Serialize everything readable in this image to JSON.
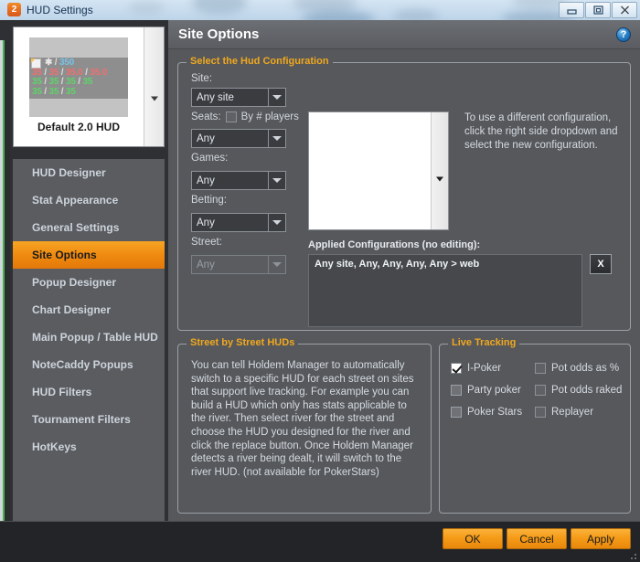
{
  "window": {
    "title": "HUD Settings",
    "icon": "app-badge-icon",
    "badge_text": "2",
    "controls": {
      "minimize": "minimize-icon",
      "maximize": "restore-icon",
      "close": "close-icon"
    }
  },
  "preview": {
    "label": "Default 2.0 HUD",
    "hud_lines": [
      {
        "segments": [
          {
            "t": "✱",
            "c": "nm"
          },
          {
            "t": " / ",
            "c": "sep"
          },
          {
            "t": "350",
            "c": "blue"
          }
        ]
      },
      {
        "segments": [
          {
            "t": "35",
            "c": "red"
          },
          {
            "t": " / ",
            "c": "sep"
          },
          {
            "t": "35",
            "c": "red"
          },
          {
            "t": " / ",
            "c": "sep"
          },
          {
            "t": "35.0",
            "c": "red"
          },
          {
            "t": " / ",
            "c": "sep"
          },
          {
            "t": "35.0",
            "c": "red"
          }
        ]
      },
      {
        "segments": [
          {
            "t": "35",
            "c": "grn"
          },
          {
            "t": " / ",
            "c": "sep"
          },
          {
            "t": "35",
            "c": "grn"
          },
          {
            "t": " / ",
            "c": "sep"
          },
          {
            "t": "35",
            "c": "grn"
          },
          {
            "t": " / ",
            "c": "sep"
          },
          {
            "t": "35",
            "c": "grn"
          }
        ]
      },
      {
        "segments": [
          {
            "t": "35",
            "c": "grn"
          },
          {
            "t": " / ",
            "c": "sep"
          },
          {
            "t": "35",
            "c": "grn"
          },
          {
            "t": " / ",
            "c": "sep"
          },
          {
            "t": "35",
            "c": "grn"
          }
        ]
      }
    ]
  },
  "sidebar": {
    "items": [
      {
        "label": "HUD Designer",
        "active": false
      },
      {
        "label": "Stat Appearance",
        "active": false
      },
      {
        "label": "General Settings",
        "active": false
      },
      {
        "label": "Site Options",
        "active": true
      },
      {
        "label": "Popup Designer",
        "active": false
      },
      {
        "label": "Chart Designer",
        "active": false
      },
      {
        "label": "Main Popup / Table HUD",
        "active": false
      },
      {
        "label": "NoteCaddy Popups",
        "active": false
      },
      {
        "label": "HUD Filters",
        "active": false
      },
      {
        "label": "Tournament Filters",
        "active": false
      },
      {
        "label": "HotKeys",
        "active": false
      }
    ]
  },
  "main": {
    "title": "Site Options",
    "help_icon": "question-mark-icon"
  },
  "config_group": {
    "title": "Select the Hud Configuration",
    "fields": {
      "site_label": "Site:",
      "site_value": "Any site",
      "seats_label": "Seats:",
      "seats_checkbox_label": "By # players",
      "seats_value": "Any",
      "games_label": "Games:",
      "games_value": "Any",
      "betting_label": "Betting:",
      "betting_value": "Any",
      "street_label": "Street:",
      "street_value": "Any"
    },
    "hint": "To use a different configuration, click the right side dropdown and select the new configuration.",
    "applied_label": "Applied Configurations (no editing):",
    "applied_rows": [
      "Any site, Any, Any, Any, Any > web"
    ],
    "remove_button": "X"
  },
  "street_group": {
    "title": "Street by Street HUDs",
    "text": "You can tell Holdem Manager to automatically switch to a specific HUD for each street on sites that support live tracking. For example you can build a HUD which only has stats applicable to the river. Then select river for the street and choose the HUD you designed for the river and click the replace button. Once Holdem Manager detects a river being dealt, it will switch to the river HUD. (not available for PokerStars)"
  },
  "live_tracking": {
    "title": "Live Tracking",
    "left_column": [
      {
        "label": "I-Poker",
        "checked": true,
        "disabled": false
      },
      {
        "label": "Party poker",
        "checked": false,
        "disabled": false
      },
      {
        "label": "Poker Stars",
        "checked": false,
        "disabled": false
      }
    ],
    "right_column": [
      {
        "label": "Pot odds as %",
        "checked": false,
        "disabled": true
      },
      {
        "label": "Pot odds raked",
        "checked": false,
        "disabled": true
      },
      {
        "label": "Replayer",
        "checked": false,
        "disabled": true
      }
    ]
  },
  "footer": {
    "ok": "OK",
    "cancel": "Cancel",
    "apply": "Apply"
  },
  "colors": {
    "accent_orange": "#f0a81e",
    "selected_item": "#ef8b10",
    "panel_bg": "#56585c",
    "sidebar_bg": "#5b5c60"
  }
}
